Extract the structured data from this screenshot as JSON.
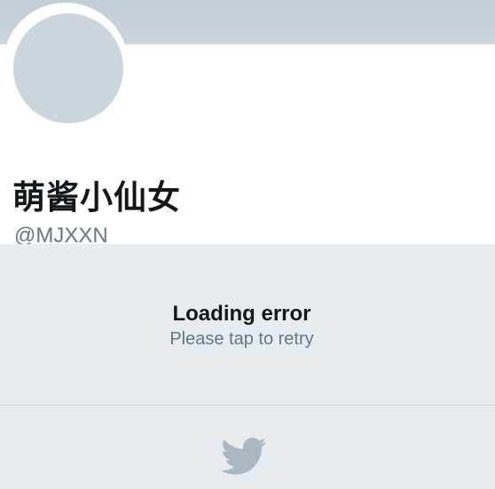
{
  "profile": {
    "display_name": "萌酱小仙女",
    "handle": "@MJXXN"
  },
  "error": {
    "title": "Loading error",
    "subtitle": "Please tap to retry"
  },
  "footer": {
    "icon": "twitter-bird-icon"
  },
  "colors": {
    "banner": "#c8d2db",
    "avatar": "#ccd6dd",
    "background": "#e6ecf0",
    "text_primary": "#14171a",
    "text_secondary": "#657786",
    "bird": "#aab8c2"
  }
}
